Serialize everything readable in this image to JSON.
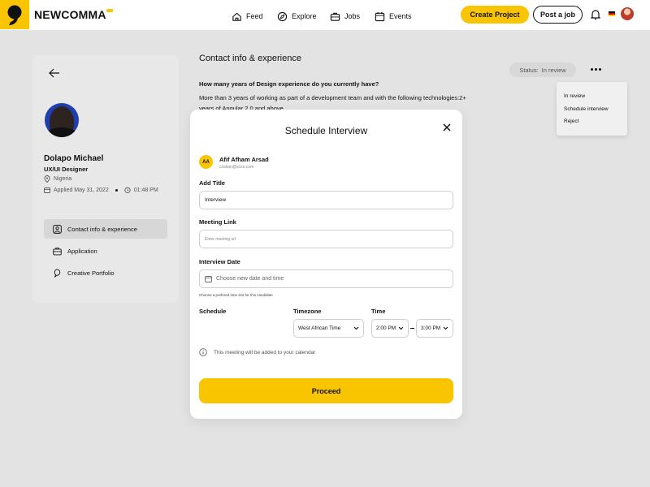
{
  "app": {
    "logo_text": "NEWCOMMA"
  },
  "nav": {
    "items": [
      {
        "label": "Feed",
        "icon": "home-icon"
      },
      {
        "label": "Explore",
        "icon": "compass-icon"
      },
      {
        "label": "Jobs",
        "icon": "briefcase-icon"
      },
      {
        "label": "Events",
        "icon": "calendar-icon"
      }
    ],
    "create_project_label": "Create Project",
    "post_job_label": "Post a job"
  },
  "profile": {
    "name": "Dolapo Michael",
    "role": "UX/UI Designer",
    "location": "Nigeria",
    "applied_date": "Applied May 31, 2022",
    "applied_time": "01:48 PM",
    "menu": [
      {
        "label": "Contact info & experience",
        "icon": "user-icon",
        "active": true
      },
      {
        "label": "Application",
        "icon": "briefcase-icon",
        "active": false
      },
      {
        "label": "Creative Portfolio",
        "icon": "comma-icon",
        "active": false
      }
    ]
  },
  "main": {
    "section_title": "Contact info & experience",
    "status_label": "Status:",
    "status_value": "In review",
    "status_menu": [
      "In review",
      "Schedule interview",
      "Reject"
    ],
    "question": "How many years of Design experience do you currently have?",
    "answer": "More than 3 years of working as part of a development team and with the following technologies:2+ years of Angular 2.0 and above"
  },
  "modal": {
    "title": "Schedule Interview",
    "interviewer_initials": "AA",
    "interviewer_name": "Afif Afham Arsad",
    "interviewer_email": "cristian@xoxo.com",
    "add_title_label": "Add Title",
    "title_value": "Interview",
    "meeting_link_label": "Meeting Link",
    "meeting_link_placeholder": "Enter meeting url",
    "interview_date_label": "Interview Date",
    "date_placeholder": "Choose new date and time",
    "date_hint": "Choose a prefered time slot for this candidate",
    "schedule_label": "Schedule",
    "timezone_label": "Timezone",
    "timezone_value": "West African Time",
    "time_label": "Time",
    "time_start": "2:00 PM",
    "time_end": "3:00 PM",
    "info_text": "This meeting will be added to your calendar",
    "proceed_label": "Proceed"
  },
  "colors": {
    "accent": "#f9c400",
    "background": "#e3e3e3"
  }
}
